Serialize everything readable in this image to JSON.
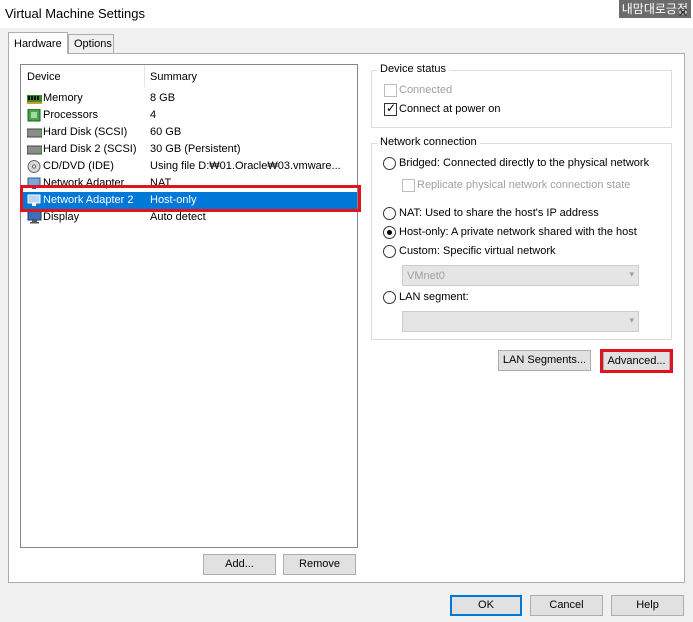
{
  "window": {
    "title": "Virtual Machine Settings",
    "watermark": "내맘대로긍정",
    "close_glyph": "✕"
  },
  "tabs": [
    {
      "label": "Hardware",
      "active": true
    },
    {
      "label": "Options",
      "active": false
    }
  ],
  "device_list": {
    "columns": {
      "device": "Device",
      "summary": "Summary"
    },
    "rows": [
      {
        "name": "Memory",
        "summary": "8 GB",
        "icon": "memory-icon"
      },
      {
        "name": "Processors",
        "summary": "4",
        "icon": "processor-icon"
      },
      {
        "name": "Hard Disk (SCSI)",
        "summary": "60 GB",
        "icon": "hard-disk-icon"
      },
      {
        "name": "Hard Disk 2 (SCSI)",
        "summary": "30 GB (Persistent)",
        "icon": "hard-disk-icon"
      },
      {
        "name": "CD/DVD (IDE)",
        "summary": "Using file D:₩01.Oracle₩03.vmware...",
        "icon": "cd-dvd-icon"
      },
      {
        "name": "Network Adapter",
        "summary": "NAT",
        "icon": "network-adapter-icon"
      },
      {
        "name": "Network Adapter 2",
        "summary": "Host-only",
        "icon": "network-adapter-icon",
        "selected": true
      },
      {
        "name": "Display",
        "summary": "Auto detect",
        "icon": "display-icon"
      }
    ],
    "add_label": "Add...",
    "remove_label": "Remove"
  },
  "device_status": {
    "title": "Device status",
    "connected_label": "Connected",
    "connected_checked": false,
    "connected_enabled": false,
    "power_on_label": "Connect at power on",
    "power_on_checked": true
  },
  "network_connection": {
    "title": "Network connection",
    "bridged_label": "Bridged: Connected directly to the physical network",
    "replicate_label": "Replicate physical network connection state",
    "nat_label": "NAT: Used to share the host's IP address",
    "hostonly_label": "Host-only: A private network shared with the host",
    "custom_label": "Custom: Specific virtual network",
    "vmnet_value": "VMnet0",
    "lan_segment_label": "LAN segment:",
    "lan_segment_value": "",
    "selected": "host-only"
  },
  "buttons": {
    "lan_segments": "LAN Segments...",
    "advanced": "Advanced...",
    "ok": "OK",
    "cancel": "Cancel",
    "help": "Help"
  },
  "colors": {
    "selection": "#0078d7",
    "highlight_box": "#e0141f"
  }
}
